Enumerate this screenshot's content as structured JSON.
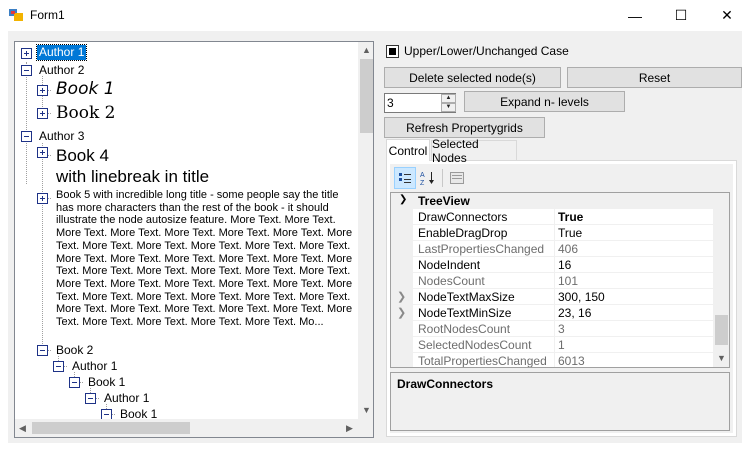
{
  "window": {
    "title": "Form1",
    "minimize_glyph": "—",
    "maximize_glyph": "☐",
    "close_glyph": "✕"
  },
  "tree": {
    "nodes": [
      {
        "label": "Author 1",
        "expander": "plus",
        "selected": true
      },
      {
        "label": "Author 2",
        "expander": "minus"
      },
      {
        "label": "Book 1",
        "expander": "plus"
      },
      {
        "label": "Book 2",
        "expander": "plus"
      },
      {
        "label": "Author 3",
        "expander": "minus"
      },
      {
        "label": "Book 4",
        "label2": "with linebreak in title",
        "expander": "plus"
      },
      {
        "label": "Book 5 with incredible long title - some people say the title has more characters than the rest of the book - it should illustrate the node autosize feature. More Text. More Text. More Text. More Text. More Text. More Text. More Text. More Text. More Text. More Text. More Text. More Text. More Text. More Text. More Text. More Text. More Text. More Text. More Text. More Text. More Text. More Text. More Text. More Text. More Text. More Text. More Text. More Text. More Text. More Text. More Text. More Text. More Text. More Text. More Text. More Text. More Text. More Text. More Text. More Text. More Text. More Text. More Text. More Text. More Text. Mo...",
        "expander": "plus"
      },
      {
        "label": "Book 2",
        "expander": "minus"
      },
      {
        "label": "Author 1",
        "expander": "minus"
      },
      {
        "label": "Book 1",
        "expander": "minus"
      },
      {
        "label": "Author 1",
        "expander": "minus"
      },
      {
        "label": "Book 1",
        "expander": "minus"
      }
    ]
  },
  "controls": {
    "case_label": "Upper/Lower/Unchanged Case",
    "case_checked": true,
    "delete_label": "Delete selected node(s)",
    "reset_label": "Reset",
    "levels_value": "3",
    "expand_label": "Expand n- levels",
    "refresh_label": "Refresh Propertygrids"
  },
  "tabs": [
    {
      "label": "Control",
      "active": true
    },
    {
      "label": "Selected Nodes",
      "active": false
    }
  ],
  "propertygrid": {
    "category": "TreeView",
    "rows": [
      {
        "name": "DrawConnectors",
        "value": "True",
        "bold": true,
        "readonly": false,
        "expandable": false
      },
      {
        "name": "EnableDragDrop",
        "value": "True",
        "bold": false,
        "readonly": false,
        "expandable": false
      },
      {
        "name": "LastPropertiesChanged",
        "value": "406",
        "bold": false,
        "readonly": true,
        "expandable": false
      },
      {
        "name": "NodeIndent",
        "value": "16",
        "bold": false,
        "readonly": false,
        "expandable": false
      },
      {
        "name": "NodesCount",
        "value": "101",
        "bold": false,
        "readonly": true,
        "expandable": false
      },
      {
        "name": "NodeTextMaxSize",
        "value": "300, 150",
        "bold": false,
        "readonly": false,
        "expandable": true
      },
      {
        "name": "NodeTextMinSize",
        "value": "23, 16",
        "bold": false,
        "readonly": false,
        "expandable": true
      },
      {
        "name": "RootNodesCount",
        "value": "3",
        "bold": false,
        "readonly": true,
        "expandable": false
      },
      {
        "name": "SelectedNodesCount",
        "value": "1",
        "bold": false,
        "readonly": true,
        "expandable": false
      },
      {
        "name": "TotalPropertiesChanged",
        "value": "6013",
        "bold": false,
        "readonly": true,
        "expandable": false
      }
    ],
    "description_title": "DrawConnectors"
  }
}
